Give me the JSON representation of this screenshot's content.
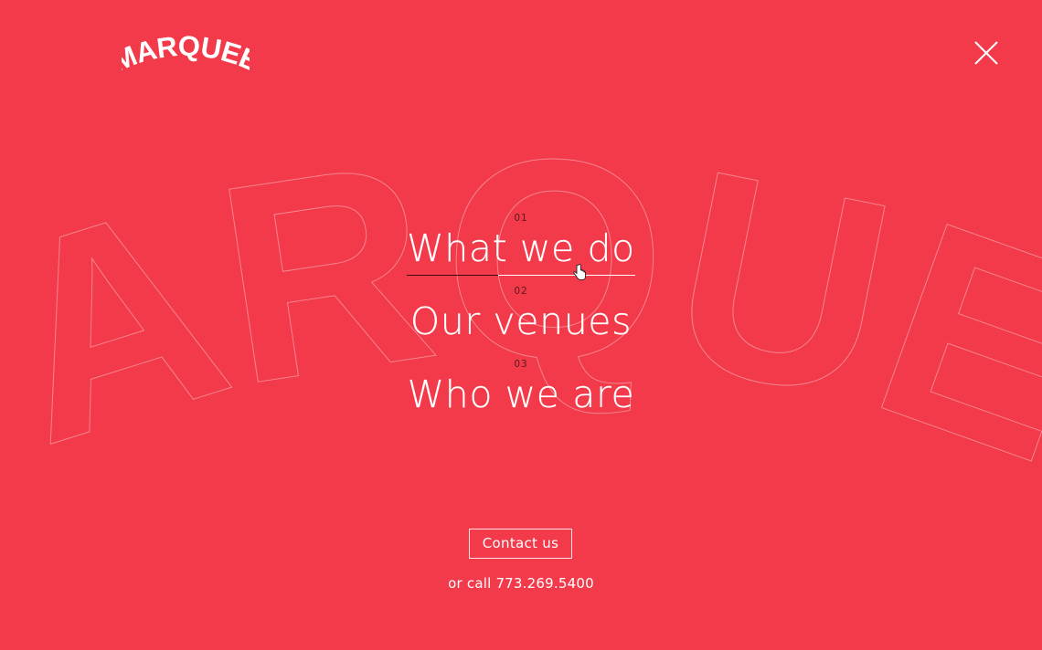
{
  "brand": {
    "logo_text": "MARQUEE",
    "background_wordmark": "MARQUEE",
    "colors": {
      "background": "#f23a4a",
      "text": "#ffffff",
      "number": "#5a1a20"
    }
  },
  "header": {
    "close_icon": "close-icon"
  },
  "menu": {
    "items": [
      {
        "number": "01",
        "label": "What we do"
      },
      {
        "number": "02",
        "label": "Our venues"
      },
      {
        "number": "03",
        "label": "Who we are"
      }
    ]
  },
  "contact": {
    "button_label": "Contact us",
    "call_prefix": "or call",
    "phone": "773.269.5400"
  }
}
